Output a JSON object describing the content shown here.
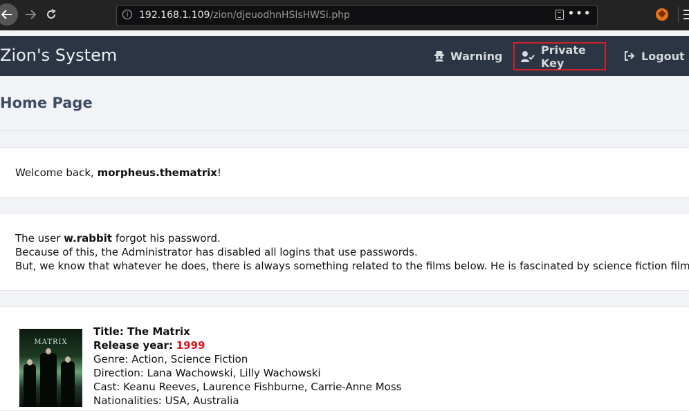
{
  "browser": {
    "url_host": "192.168.1.109",
    "url_path": "/zion/djeuodhnHSlsHWSi.php",
    "icons": [
      "back-arrow-icon",
      "forward-arrow-icon",
      "reload-icon",
      "info-icon",
      "reader-view-icon",
      "more-dots-icon",
      "extension-icon",
      "menu-icon"
    ]
  },
  "header": {
    "site_title": "Zion's System",
    "nav": {
      "warning": "Warning",
      "private_key": "Private Key",
      "logout": "Logout"
    },
    "highlight_color": "#d0202a"
  },
  "page": {
    "title": "Home Page"
  },
  "welcome": {
    "prefix": "Welcome back, ",
    "username": "morpheus.thematrix",
    "suffix": "!"
  },
  "notice": {
    "l1_prefix": "The user ",
    "l1_user": "w.rabbit",
    "l1_suffix": " forgot his password.",
    "l2": "Because of this, the Administrator has disabled all logins that use passwords.",
    "l3": "But, we know that whatever he does, there is always something related to the films below. He is fascinated by science fiction films."
  },
  "movie": {
    "poster_text": "MATRIX",
    "title_label": "Title:",
    "title_value": " The Matrix",
    "year_label": "Release year:",
    "year_value": "1999",
    "genre": "Genre: Action, Science Fiction",
    "direction": "Direction: Lana Wachowski, Lilly Wachowski",
    "cast": "Cast: Keanu Reeves, Laurence Fishburne, Carrie-Anne Moss",
    "nationalities": "Nationalities: USA, Australia"
  }
}
